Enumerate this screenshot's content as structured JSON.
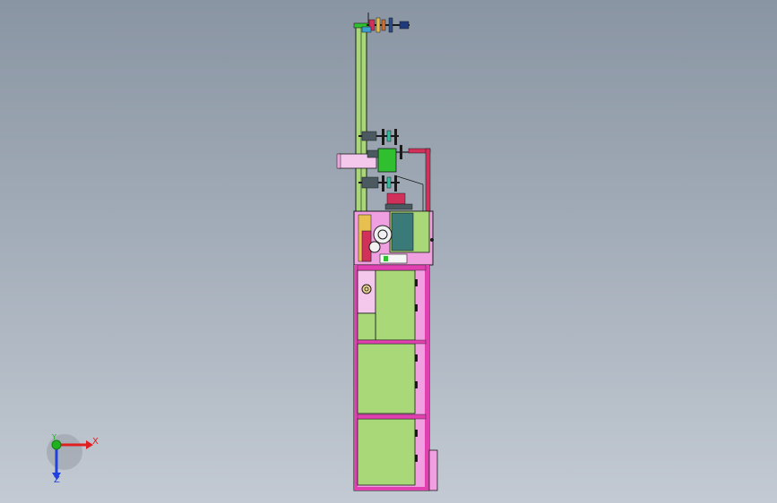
{
  "viewport": {
    "background_top": "#8a95a3",
    "background_bottom": "#c3cad3"
  },
  "model": {
    "panel_color": "#a8d878",
    "frame_color": "#e040b0",
    "cabinet_color": "#f0a0e0",
    "edge_color": "#1a1a1a",
    "pink_roller_color": "#f4c8ec",
    "green_motor_color": "#2fbf2f",
    "red_accent_color": "#d0305a",
    "teal_block_color": "#3a7a78"
  },
  "triad": {
    "x_label": "X",
    "y_label": "Y",
    "z_label": "Z",
    "x_color": "#e02020",
    "y_color": "#20b020",
    "z_color": "#2040e0"
  }
}
